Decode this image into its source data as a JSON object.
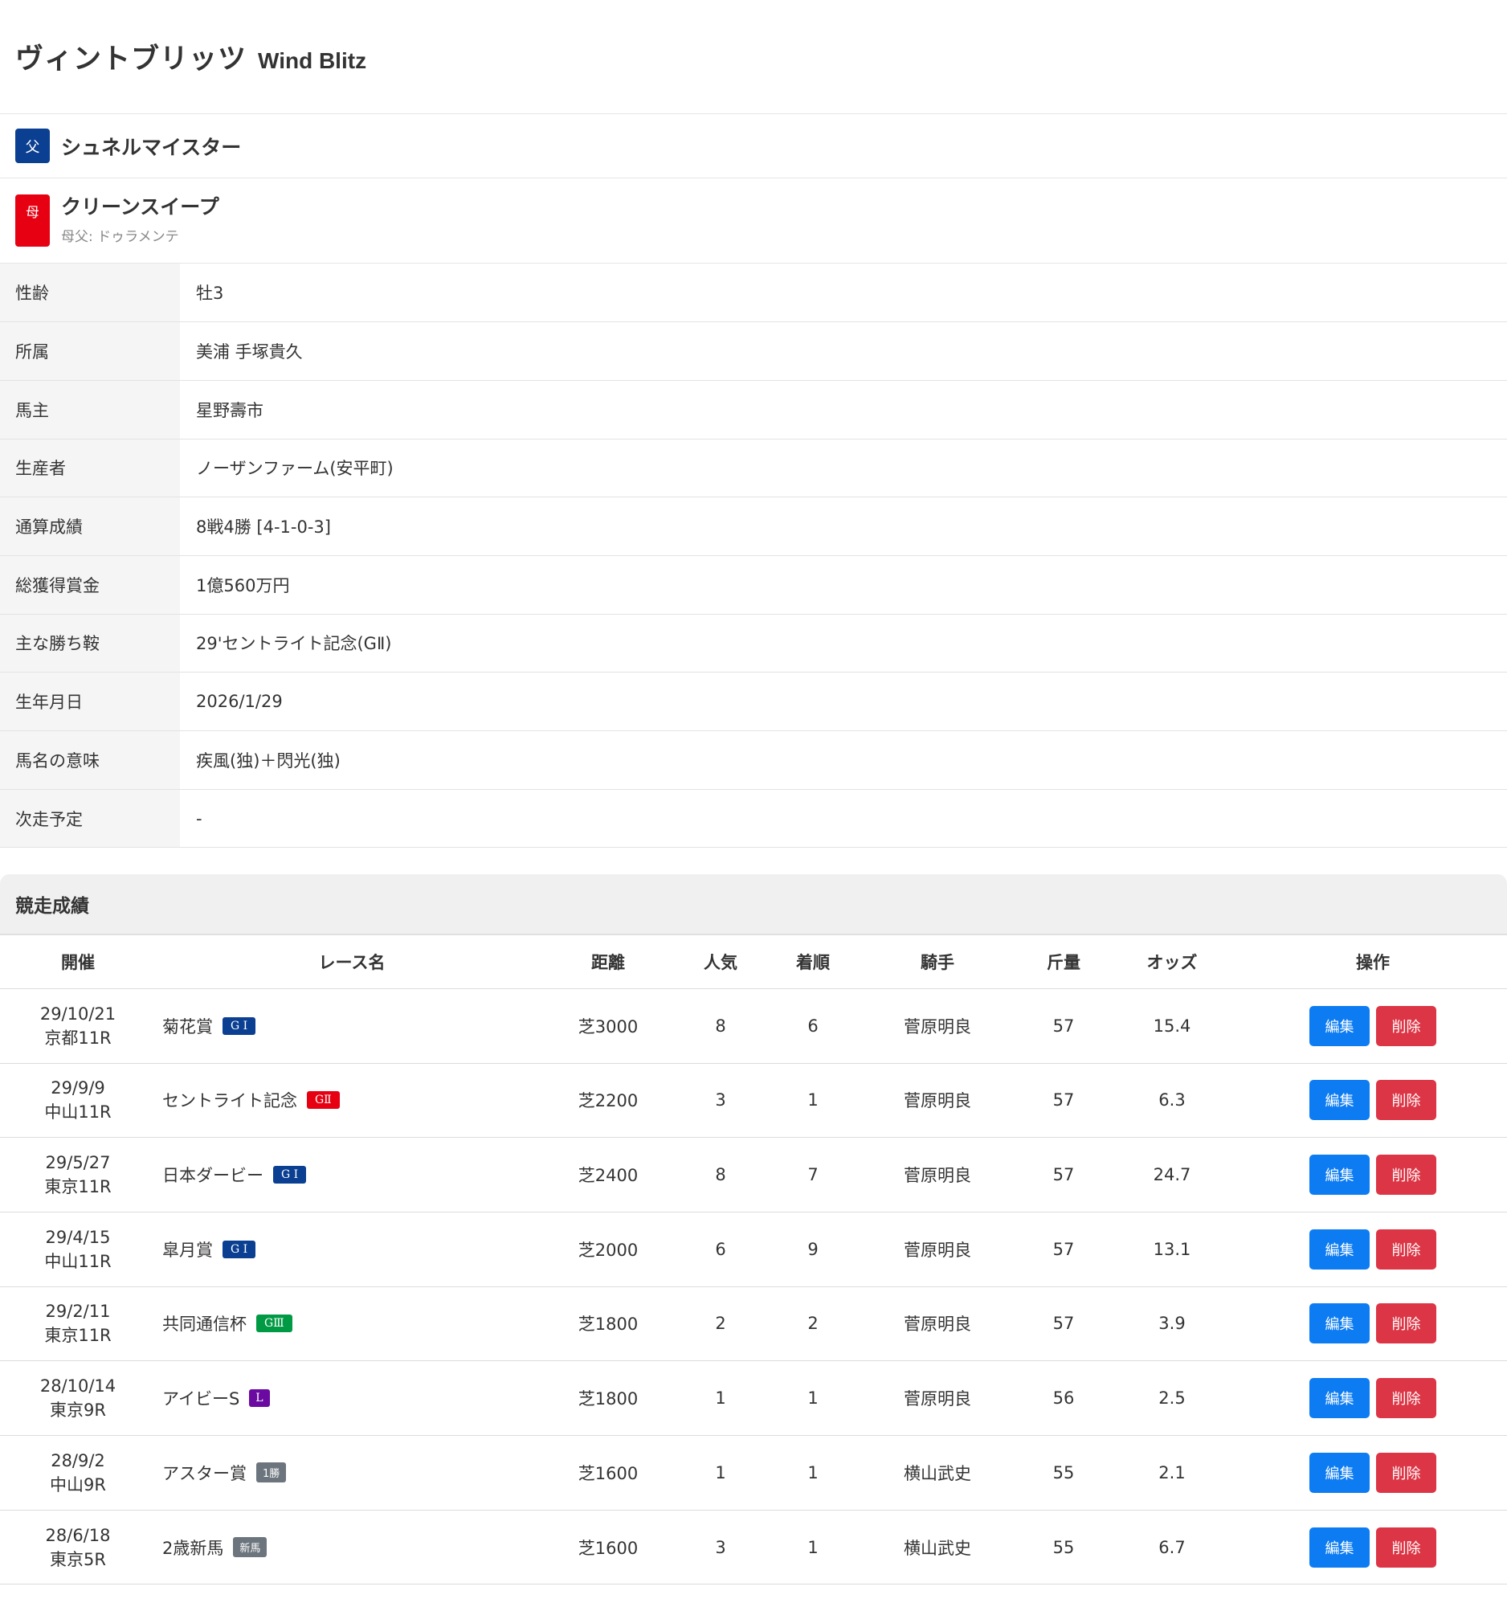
{
  "horse": {
    "name_jp": "ヴィントブリッツ",
    "name_en": "Wind Blitz"
  },
  "pedigree": {
    "sire_badge": "父",
    "sire": "シュネルマイスター",
    "dam_badge": "母",
    "dam": "クリーンスイープ",
    "damsire": "母父: ドゥラメンテ"
  },
  "profile": [
    {
      "label": "性齢",
      "value": "牡3"
    },
    {
      "label": "所属",
      "value": "美浦 手塚貴久"
    },
    {
      "label": "馬主",
      "value": "星野壽市"
    },
    {
      "label": "生産者",
      "value": "ノーザンファーム(安平町)"
    },
    {
      "label": "通算成績",
      "value": "8戦4勝 [4-1-0-3]"
    },
    {
      "label": "総獲得賞金",
      "value": "1億560万円"
    },
    {
      "label": "主な勝ち鞍",
      "value": "29'セントライト記念(GⅡ)"
    },
    {
      "label": "生年月日",
      "value": "2026/1/29"
    },
    {
      "label": "馬名の意味",
      "value": "疾風(独)＋閃光(独)"
    },
    {
      "label": "次走予定",
      "value": "-"
    }
  ],
  "races": {
    "section_title": "競走成績",
    "headers": {
      "date": "開催",
      "name": "レース名",
      "distance": "距離",
      "popularity": "人気",
      "finish": "着順",
      "jockey": "騎手",
      "weight": "斤量",
      "odds": "オッズ",
      "actions": "操作"
    },
    "edit_label": "編集",
    "delete_label": "削除",
    "rows": [
      {
        "date": "29/10/21",
        "venue": "京都11R",
        "name": "菊花賞",
        "grade": "G I",
        "grade_class": "g1",
        "distance": "芝3000",
        "popularity": "8",
        "finish": "6",
        "jockey": "菅原明良",
        "weight": "57",
        "odds": "15.4"
      },
      {
        "date": "29/9/9",
        "venue": "中山11R",
        "name": "セントライト記念",
        "grade": "GⅡ",
        "grade_class": "g2",
        "distance": "芝2200",
        "popularity": "3",
        "finish": "1",
        "jockey": "菅原明良",
        "weight": "57",
        "odds": "6.3"
      },
      {
        "date": "29/5/27",
        "venue": "東京11R",
        "name": "日本ダービー",
        "grade": "G I",
        "grade_class": "g1",
        "distance": "芝2400",
        "popularity": "8",
        "finish": "7",
        "jockey": "菅原明良",
        "weight": "57",
        "odds": "24.7"
      },
      {
        "date": "29/4/15",
        "venue": "中山11R",
        "name": "皐月賞",
        "grade": "G I",
        "grade_class": "g1",
        "distance": "芝2000",
        "popularity": "6",
        "finish": "9",
        "jockey": "菅原明良",
        "weight": "57",
        "odds": "13.1"
      },
      {
        "date": "29/2/11",
        "venue": "東京11R",
        "name": "共同通信杯",
        "grade": "GⅢ",
        "grade_class": "g3",
        "distance": "芝1800",
        "popularity": "2",
        "finish": "2",
        "jockey": "菅原明良",
        "weight": "57",
        "odds": "3.9"
      },
      {
        "date": "28/10/14",
        "venue": "東京9R",
        "name": "アイビーS",
        "grade": "L",
        "grade_class": "gl",
        "distance": "芝1800",
        "popularity": "1",
        "finish": "1",
        "jockey": "菅原明良",
        "weight": "56",
        "odds": "2.5"
      },
      {
        "date": "28/9/2",
        "venue": "中山9R",
        "name": "アスター賞",
        "grade": "1勝",
        "grade_class": "gc",
        "distance": "芝1600",
        "popularity": "1",
        "finish": "1",
        "jockey": "横山武史",
        "weight": "55",
        "odds": "2.1"
      },
      {
        "date": "28/6/18",
        "venue": "東京5R",
        "name": "2歳新馬",
        "grade": "新馬",
        "grade_class": "gc",
        "distance": "芝1600",
        "popularity": "3",
        "finish": "1",
        "jockey": "横山武史",
        "weight": "55",
        "odds": "6.7"
      }
    ]
  }
}
